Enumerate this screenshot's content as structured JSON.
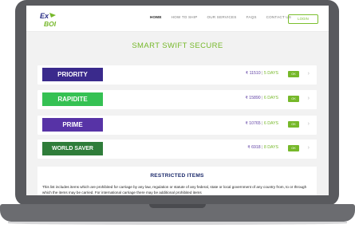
{
  "brand": {
    "logo_text_top": "Ex",
    "logo_text_bottom": "BOI"
  },
  "nav": {
    "items": [
      "HOME",
      "HOW TO SHIP",
      "OUR SERVICES",
      "FAQS",
      "CONTACT US"
    ],
    "active": "HOME",
    "login_label": "LOGIN"
  },
  "page_title": "SMART SWIFT SECURE",
  "services": [
    {
      "name": "PRIORITY",
      "color": "#3a2a8c",
      "price": "₹ 11510",
      "days": "5 DAYS",
      "ok": "OK"
    },
    {
      "name": "RAPIDITE",
      "color": "#35c153",
      "price": "₹ 15890",
      "days": "6 DAYS",
      "ok": "OK"
    },
    {
      "name": "PRIME",
      "color": "#5733a6",
      "price": "₹ 10765",
      "days": "6 DAYS",
      "ok": "OK"
    },
    {
      "name": "WORLD SAVER",
      "color": "#2f7d3a",
      "price": "₹ 6918",
      "days": "8 DAYS",
      "ok": "OK"
    }
  ],
  "restricted": {
    "title": "RESTRICTED ITEMS",
    "text": "This list includes items which are prohibited for carriage by any law, regulation or statute of any federal, state or local government of any country from, to or through which the items may be carried. For international carriage there may be additional prohibited items"
  },
  "colors": {
    "accent_green": "#76b82a",
    "price_purple": "#5e3fa3",
    "frame": "#595a5e"
  },
  "icons": {
    "row_arrow": "chevron-right-icon"
  }
}
